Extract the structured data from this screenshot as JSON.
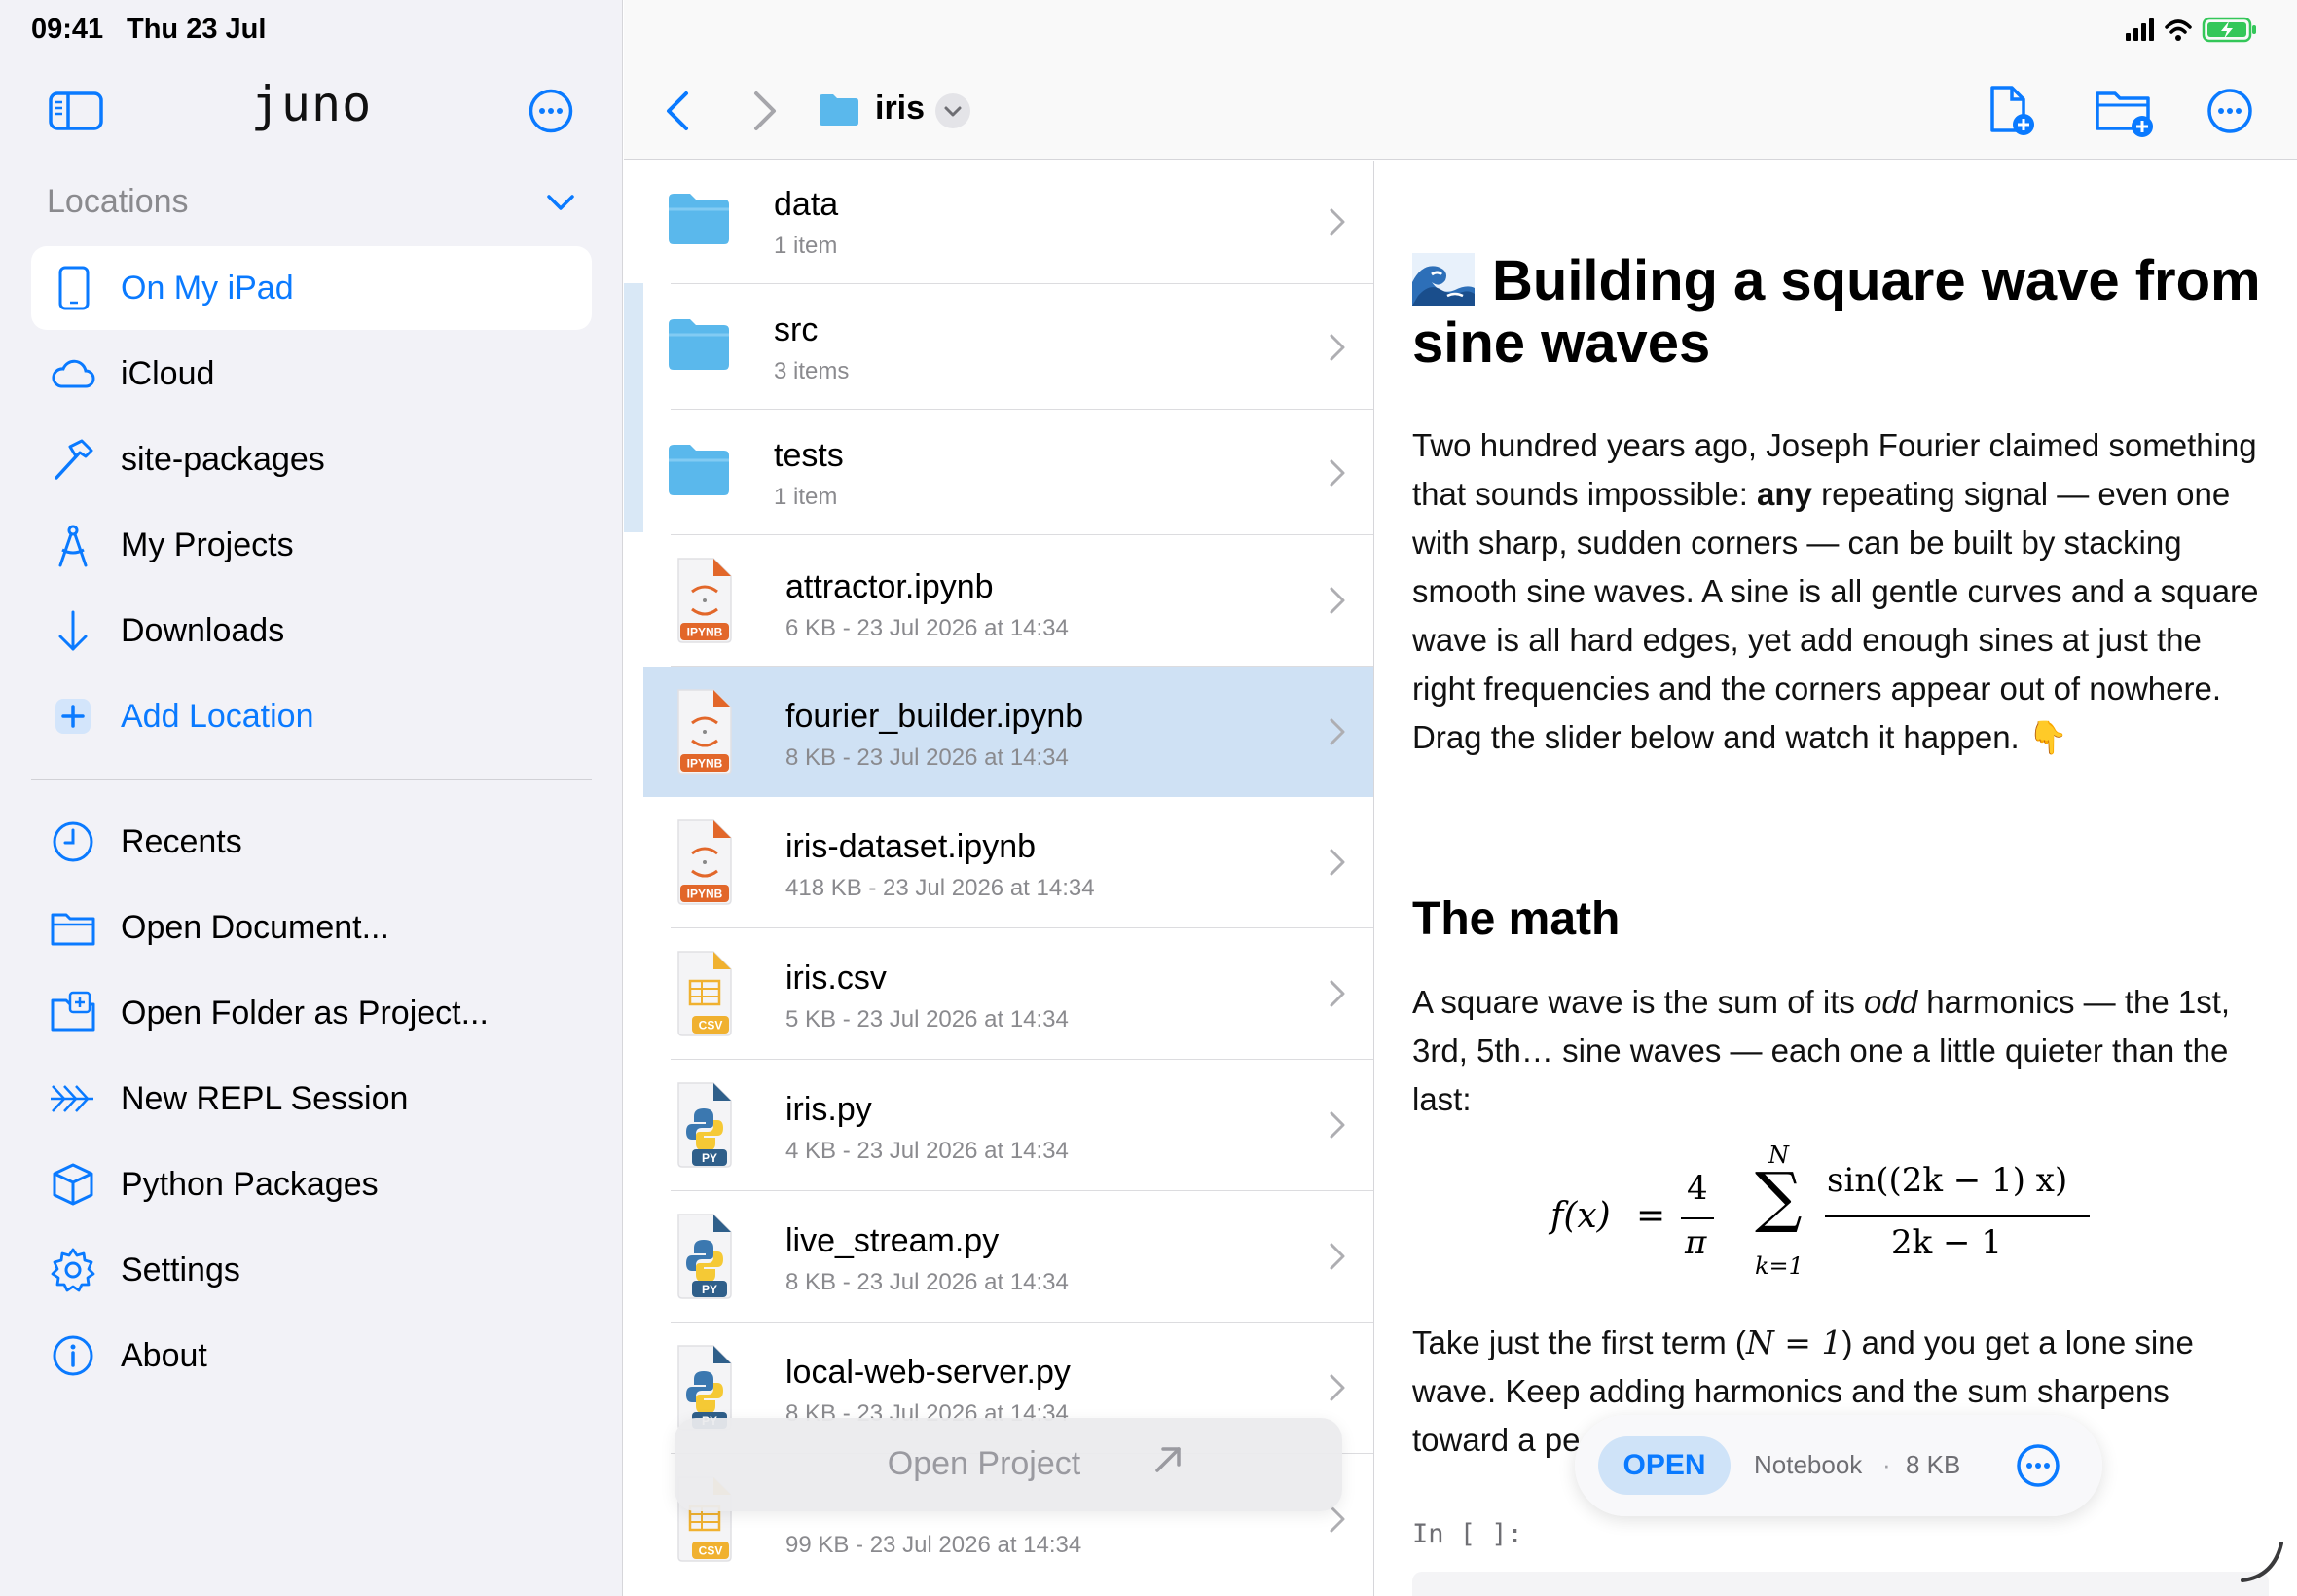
{
  "status": {
    "time": "09:41",
    "date": "Thu 23 Jul"
  },
  "app": {
    "title": "juno"
  },
  "sidebar": {
    "locations_header": "Locations",
    "locations": [
      {
        "label": "On My iPad",
        "icon": "ipad-icon",
        "selected": true
      },
      {
        "label": "iCloud",
        "icon": "cloud-icon"
      },
      {
        "label": "site-packages",
        "icon": "hammer-icon"
      },
      {
        "label": "My Projects",
        "icon": "compass-icon"
      },
      {
        "label": "Downloads",
        "icon": "arrow-down-icon"
      },
      {
        "label": "Add Location",
        "icon": "plus-square-icon"
      }
    ],
    "actions": [
      {
        "label": "Recents",
        "icon": "clock-icon"
      },
      {
        "label": "Open Document...",
        "icon": "folder-icon"
      },
      {
        "label": "Open Folder as Project...",
        "icon": "folder-plus-icon"
      },
      {
        "label": "New REPL Session",
        "icon": "chevrons-right-icon"
      },
      {
        "label": "Python Packages",
        "icon": "package-icon"
      },
      {
        "label": "Settings",
        "icon": "gear-icon"
      },
      {
        "label": "About",
        "icon": "info-icon"
      }
    ]
  },
  "toolbar": {
    "folder_name": "iris"
  },
  "files": [
    {
      "name": "data",
      "meta": "1 item",
      "type": "folder"
    },
    {
      "name": "src",
      "meta": "3 items",
      "type": "folder"
    },
    {
      "name": "tests",
      "meta": "1 item",
      "type": "folder"
    },
    {
      "name": "attractor.ipynb",
      "meta": "6 KB - 23 Jul 2026 at 14:34",
      "type": "ipynb",
      "badge": "IPYNB"
    },
    {
      "name": "fourier_builder.ipynb",
      "meta": "8 KB - 23 Jul 2026 at 14:34",
      "type": "ipynb",
      "badge": "IPYNB",
      "selected": true
    },
    {
      "name": "iris-dataset.ipynb",
      "meta": "418 KB - 23 Jul 2026 at 14:34",
      "type": "ipynb",
      "badge": "IPYNB"
    },
    {
      "name": "iris.csv",
      "meta": "5 KB - 23 Jul 2026 at 14:34",
      "type": "csv",
      "badge": "CSV"
    },
    {
      "name": "iris.py",
      "meta": "4 KB - 23 Jul 2026 at 14:34",
      "type": "py",
      "badge": "PY"
    },
    {
      "name": "live_stream.py",
      "meta": "8 KB - 23 Jul 2026 at 14:34",
      "type": "py",
      "badge": "PY"
    },
    {
      "name": "local-web-server.py",
      "meta": "8 KB - 23 Jul 2026 at 14:34",
      "type": "py",
      "badge": "PY"
    },
    {
      "name": "",
      "meta": "99 KB - 23 Jul 2026 at 14:34",
      "type": "csv",
      "badge": "CSV"
    }
  ],
  "open_project": {
    "label": "Open Project"
  },
  "preview": {
    "title": "Building a square wave from sine waves",
    "intro_before": "Two hundred years ago, Joseph Fourier claimed something that sounds impossible: ",
    "intro_bold": "any",
    "intro_after": " repeating signal — even one with sharp, sudden corners — can be built by stacking smooth sine waves. A sine is all gentle curves and a square wave is all hard edges, yet add enough sines at just the right frequencies and the corners appear out of nowhere. Drag the slider below and watch it happen. 👇",
    "math_heading": "The math",
    "math_before": "A square wave is the sum of its ",
    "math_italic": "odd",
    "math_after": " harmonics — the 1st, 3rd, 5th… sine waves — each one a little quieter than the last:",
    "formula": {
      "lhs": "f(x)",
      "eq": "=",
      "coef_num": "4",
      "coef_den": "π",
      "sum_top": "N",
      "sum_sym": "∑",
      "sum_bottom": "k=1",
      "frac_num": "sin((2k − 1) x)",
      "frac_den": "2k − 1"
    },
    "take_before": "Take just the first term (",
    "take_math": "N = 1",
    "take_after": ") and you get a lone sine wave. Keep adding harmonics and the sum sharpens toward a pe",
    "cell_prompt": "In [ ]:"
  },
  "action_pill": {
    "open_label": "OPEN",
    "kind": "Notebook",
    "dot": "·",
    "size": "8 KB"
  },
  "colors": {
    "accent": "#0a7aff",
    "selected_row": "#cfe1f4",
    "folder": "#5ab8ec",
    "ipynb": "#e2672a",
    "csv": "#f0b130",
    "py": "#2f5f8a"
  }
}
